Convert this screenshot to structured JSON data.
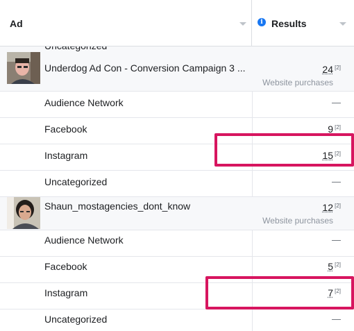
{
  "header": {
    "ad_column_label": "Ad",
    "results_column_label": "Results",
    "info_glyph": "i"
  },
  "peek_text": "Uncategorized",
  "ads": [
    {
      "name": "Underdog Ad Con - Conversion Campaign 3 ...",
      "results": "24",
      "footnote": "[2]",
      "result_type": "Website purchases",
      "breakdown": [
        {
          "label": "Audience Network",
          "value": "—",
          "footnote": ""
        },
        {
          "label": "Facebook",
          "value": "9",
          "footnote": "[2]"
        },
        {
          "label": "Instagram",
          "value": "15",
          "footnote": "[2]"
        },
        {
          "label": "Uncategorized",
          "value": "—",
          "footnote": ""
        }
      ]
    },
    {
      "name": "Shaun_mostagencies_dont_know",
      "results": "12",
      "footnote": "[2]",
      "result_type": "Website purchases",
      "breakdown": [
        {
          "label": "Audience Network",
          "value": "—",
          "footnote": ""
        },
        {
          "label": "Facebook",
          "value": "5",
          "footnote": "[2]"
        },
        {
          "label": "Instagram",
          "value": "7",
          "footnote": "[2]"
        },
        {
          "label": "Uncategorized",
          "value": "—",
          "footnote": ""
        }
      ]
    }
  ],
  "colors": {
    "highlight": "#d7155f",
    "info_icon": "#1877f2",
    "row_border": "#e4e6eb",
    "ad_row_bg": "#f7f8fa"
  }
}
